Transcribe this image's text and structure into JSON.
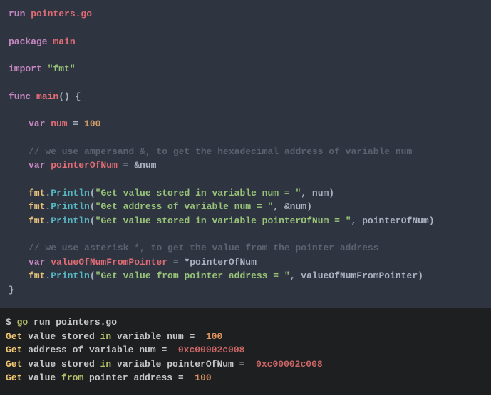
{
  "editor": {
    "l1_kw": "run",
    "l1_file": " pointers.go",
    "l2_kw": "package",
    "l2_name": " main",
    "l3_kw": "import",
    "l3_str": " \"fmt\"",
    "l4_kw": "func",
    "l4_name": " main",
    "l4_parens": "() {",
    "l5_kw": "var",
    "l5_name": " num",
    "l5_eq": " = ",
    "l5_val": "100",
    "l6": "// we use ampersand &, to get the hexadecimal address of variable num",
    "l7_kw": "var",
    "l7_name": " pointerOfNum",
    "l7_rest": " = &num",
    "l8_pkg": "fmt",
    "l8_dot": ".",
    "l8_fn": "Println",
    "l8_paren": "(",
    "l8_str": "\"Get value stored in variable num = \"",
    "l8_rest": ", num)",
    "l9_pkg": "fmt",
    "l9_dot": ".",
    "l9_fn": "Println",
    "l9_paren": "(",
    "l9_str": "\"Get address of variable num = \"",
    "l9_rest": ", &num)",
    "l10_pkg": "fmt",
    "l10_dot": ".",
    "l10_fn": "Println",
    "l10_paren": "(",
    "l10_str": "\"Get value stored in variable pointerOfNum = \"",
    "l10_rest": ", pointerOfNum)",
    "l11": "// we use asterisk *, to get the value from the pointer address",
    "l12_kw": "var",
    "l12_name": " valueOfNumFromPointer",
    "l12_rest": " = *pointerOfNum",
    "l13_pkg": "fmt",
    "l13_dot": ".",
    "l13_fn": "Println",
    "l13_paren": "(",
    "l13_str": "\"Get value from pointer address = \"",
    "l13_rest": ", valueOfNumFromPointer)",
    "l14": "}"
  },
  "terminal": {
    "p_dollar": "$ ",
    "p_cmd1": "go",
    "p_cmd2": " run pointers.go",
    "r1_a": "Get",
    "r1_b": " value stored ",
    "r1_c": "in",
    "r1_d": " variable num =  ",
    "r1_e": "100",
    "r2_a": "Get",
    "r2_b": " address of variable num =  ",
    "r2_c": "0xc00002c008",
    "r3_a": "Get",
    "r3_b": " value stored ",
    "r3_c": "in",
    "r3_d": " variable pointerOfNum =  ",
    "r3_e": "0xc00002c008",
    "r4_a": "Get",
    "r4_b": " value ",
    "r4_c": "from",
    "r4_d": " pointer address =  ",
    "r4_e": "100"
  }
}
